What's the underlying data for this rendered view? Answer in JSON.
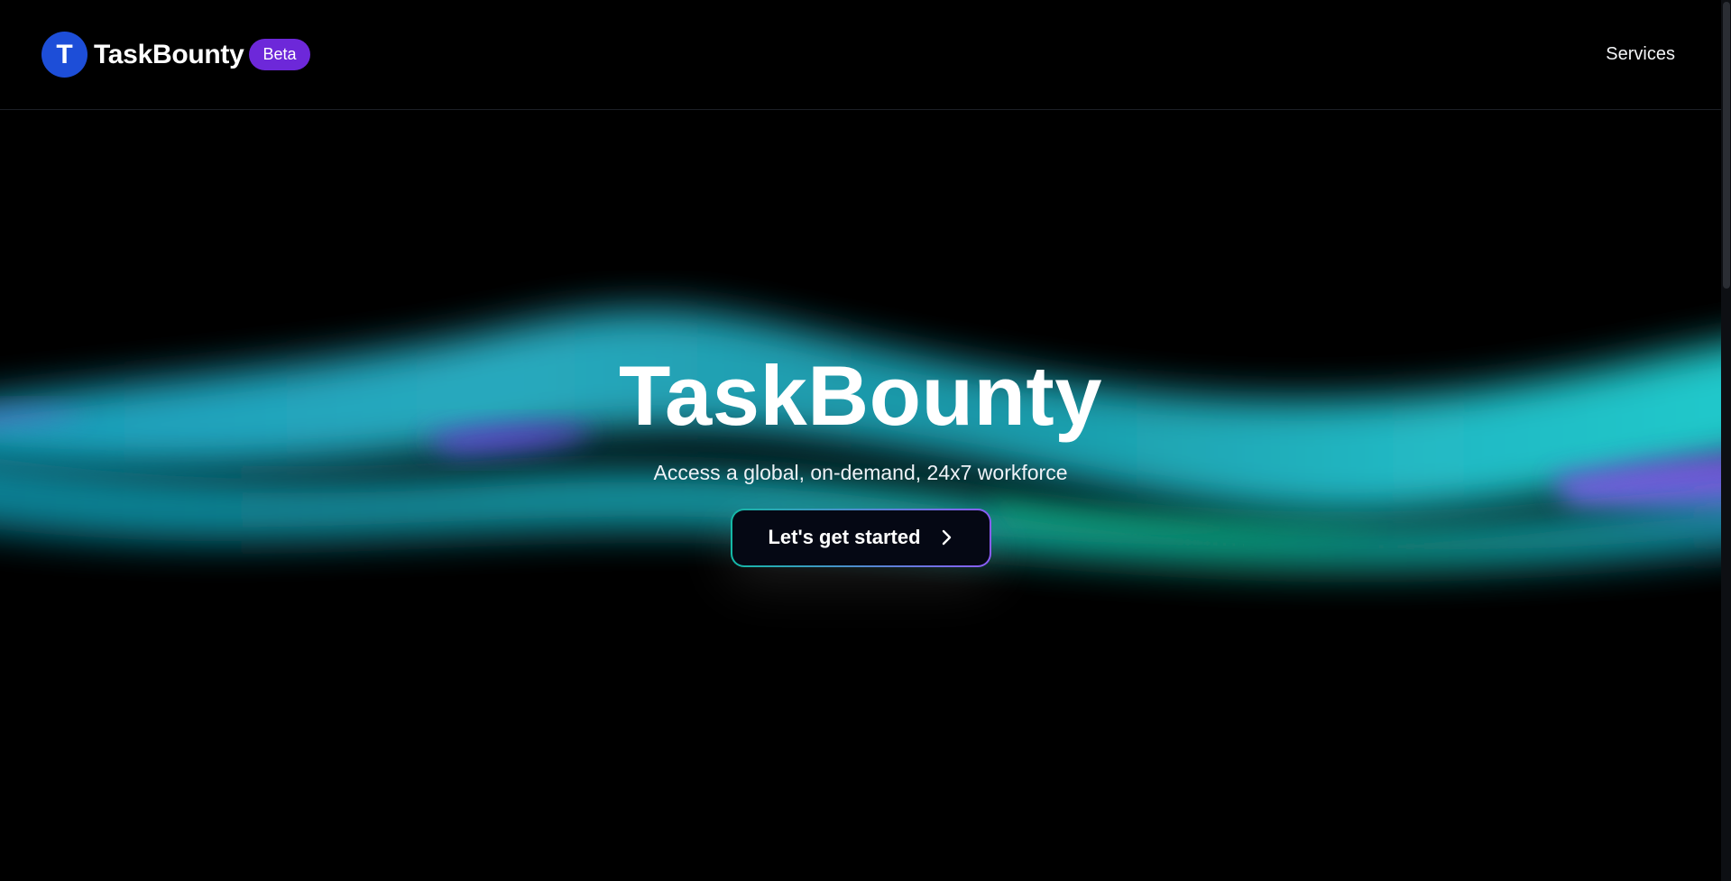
{
  "header": {
    "logo_letter": "T",
    "brand_name": "TaskBounty",
    "badge": "Beta",
    "nav": {
      "services": "Services"
    }
  },
  "hero": {
    "title": "TaskBounty",
    "subtitle": "Access a global, on-demand, 24x7 workforce",
    "cta_label": "Let's get started",
    "cta_icon": "chevron-right-icon"
  },
  "colors": {
    "logo": "#1d4ed8",
    "badge": "#6d28d9",
    "aurora_teal": "#22d3ee",
    "aurora_purple": "#8b5cf6",
    "background": "#000000"
  }
}
